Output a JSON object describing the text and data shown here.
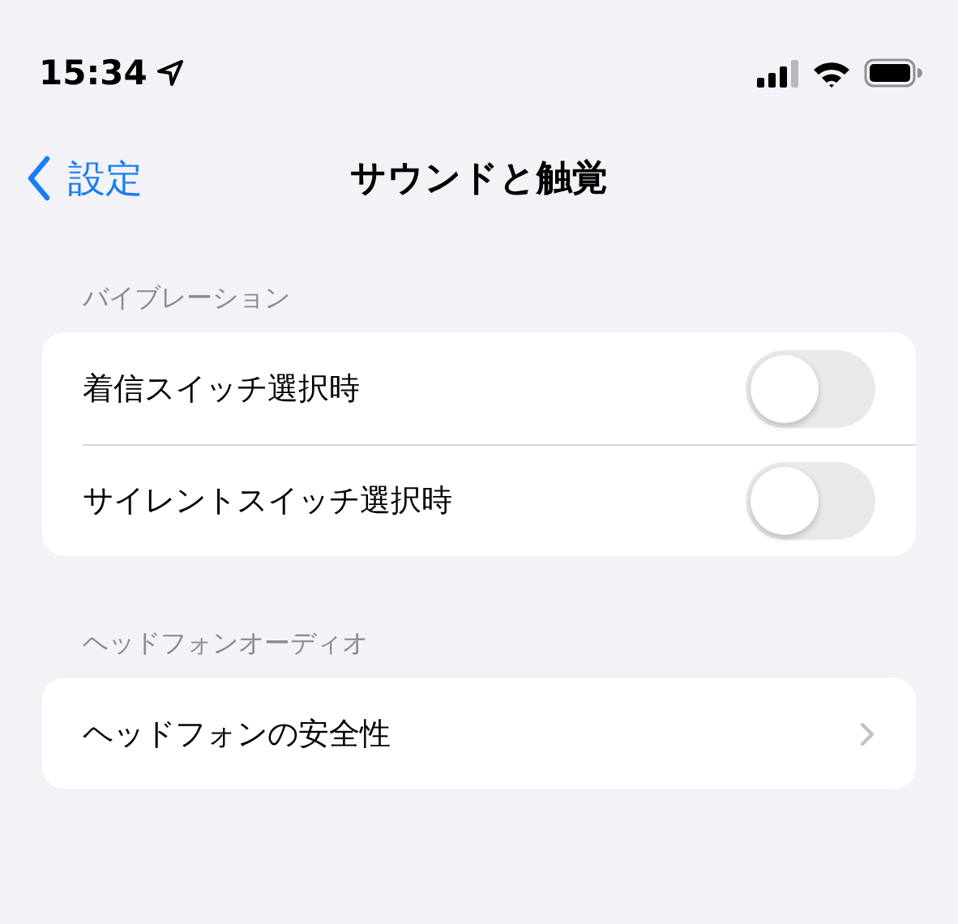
{
  "status_bar": {
    "time": "15:34"
  },
  "nav": {
    "back_label": "設定",
    "title": "サウンドと触覚"
  },
  "sections": [
    {
      "header": "バイブレーション",
      "rows": [
        {
          "kind": "toggle",
          "label": "着信スイッチ選択時",
          "on": false
        },
        {
          "kind": "toggle",
          "label": "サイレントスイッチ選択時",
          "on": false
        }
      ]
    },
    {
      "header": "ヘッドフォンオーディオ",
      "rows": [
        {
          "kind": "link",
          "label": "ヘッドフォンの安全性"
        }
      ]
    }
  ]
}
